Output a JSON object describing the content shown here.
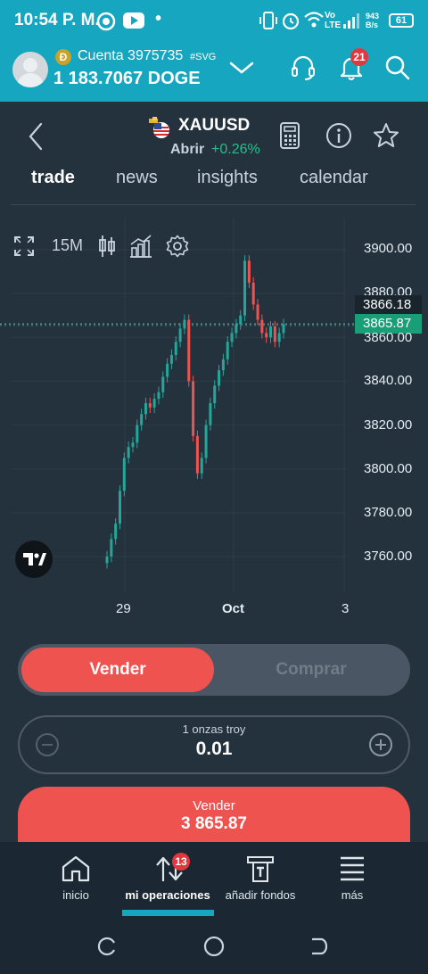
{
  "status_bar": {
    "time": "10:54 P. M.",
    "signal_label": "Vo LTE",
    "speed_top": "943",
    "speed_bottom": "B/s",
    "battery": "61"
  },
  "account": {
    "label": "Cuenta 3975735",
    "tag": "#SVG",
    "balance": "1 183.7067 DOGE",
    "coin_badge": "Ð",
    "notification_count": "21"
  },
  "instrument": {
    "symbol": "XAUUSD",
    "status": "Abrir",
    "change": "+0.26%"
  },
  "tabs": [
    {
      "label": "trade",
      "active": true
    },
    {
      "label": "news",
      "active": false
    },
    {
      "label": "insights",
      "active": false
    },
    {
      "label": "calendar",
      "active": false
    }
  ],
  "chart_toolbar": {
    "timeframe": "15M"
  },
  "chart_data": {
    "type": "line",
    "title": "",
    "timeframe": "15M",
    "y_ticks": [
      "3900.00",
      "3880.00",
      "3866.18",
      "3865.87",
      "3860.00",
      "3840.00",
      "3820.00",
      "3800.00",
      "3780.00",
      "3760.00"
    ],
    "x_ticks": [
      "29",
      "Oct",
      "3"
    ],
    "ylim": [
      3750,
      3910
    ],
    "series": [
      {
        "values": [
          3760,
          3768,
          3775,
          3790,
          3805,
          3810,
          3812,
          3820,
          3825,
          3830,
          3828,
          3832,
          3835,
          3842,
          3848,
          3852,
          3858,
          3864,
          3868,
          3840,
          3815,
          3798,
          3805,
          3820,
          3830,
          3838,
          3845,
          3850,
          3858,
          3862,
          3866,
          3870,
          3895,
          3885,
          3875,
          3868,
          3862,
          3860,
          3865,
          3858,
          3862,
          3866
        ]
      }
    ],
    "current_bid": "3866.18",
    "current_ask": "3865.87",
    "grid": true
  },
  "trade": {
    "sell_tab": "Vender",
    "buy_tab": "Comprar",
    "quantity_label": "1 onzas troy",
    "quantity_value": "0.01",
    "action_label": "Vender",
    "action_price": "3 865.87"
  },
  "bottom_nav": [
    {
      "label": "inicio",
      "active": false
    },
    {
      "label": "mi operaciones",
      "active": true,
      "badge": "13"
    },
    {
      "label": "añadir fondos",
      "active": false
    },
    {
      "label": "más",
      "active": false
    }
  ],
  "colors": {
    "accent": "#17a6bf",
    "sell": "#ef5350",
    "buy_price": "#1a9e77",
    "bg": "#24323e"
  }
}
